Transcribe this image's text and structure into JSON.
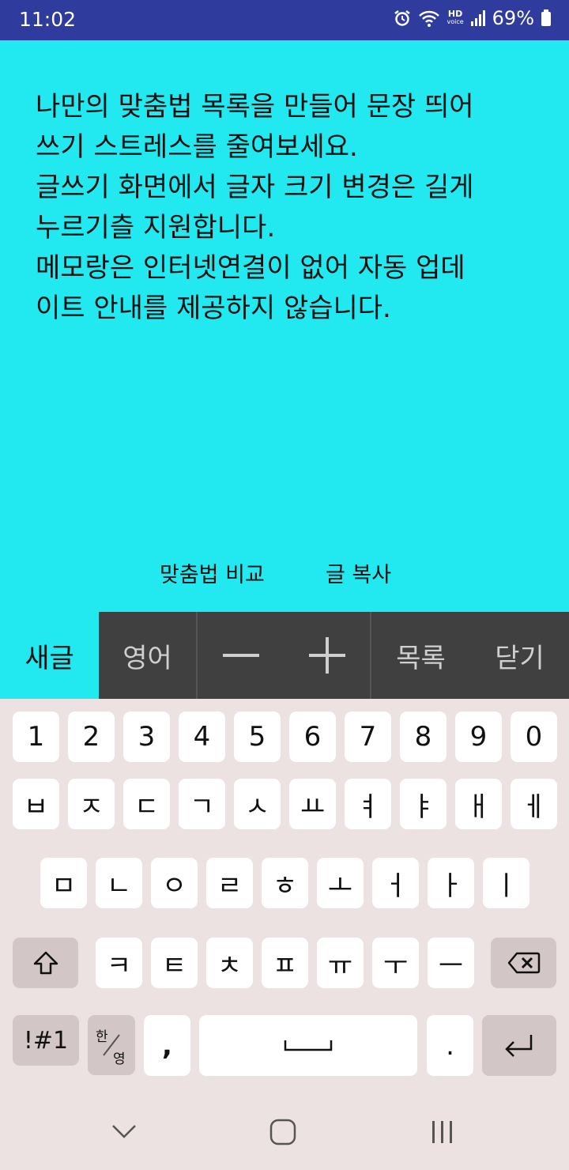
{
  "status": {
    "time": "11:02",
    "hd": "HD",
    "voice": "voice",
    "battery": "69%"
  },
  "memo": {
    "text": "나만의 맞춤법 목록을 만들어 문장 띄어\n쓰기 스트레스를 줄여보세요.\n글쓰기 화면에서 글자 크기 변경은 길게\n누르기츨 지원합니다.\n메모랑은 인터넷연결이 없어 자동 업데\n이트 안내를 제공하지 않습니다.",
    "compare_label": "맞춤법 비교",
    "copy_label": "글 복사"
  },
  "toolbar": {
    "new_label": "새글",
    "english_label": "영어",
    "list_label": "목록",
    "close_label": "닫기",
    "accent": "#22e8f0"
  },
  "keyboard": {
    "numbers": [
      "1",
      "2",
      "3",
      "4",
      "5",
      "6",
      "7",
      "8",
      "9",
      "0"
    ],
    "row1": [
      "ㅂ",
      "ㅈ",
      "ㄷ",
      "ㄱ",
      "ㅅ",
      "ㅛ",
      "ㅕ",
      "ㅑ",
      "ㅐ",
      "ㅔ"
    ],
    "row2": [
      "ㅁ",
      "ㄴ",
      "ㅇ",
      "ㄹ",
      "ㅎ",
      "ㅗ",
      "ㅓ",
      "ㅏ",
      "ㅣ"
    ],
    "row3": [
      "ㅋ",
      "ㅌ",
      "ㅊ",
      "ㅍ",
      "ㅠ",
      "ㅜ",
      "ㅡ"
    ],
    "symbols_label": "!#1",
    "lang_top": "한",
    "lang_bottom": "영",
    "comma": ",",
    "period": "."
  }
}
